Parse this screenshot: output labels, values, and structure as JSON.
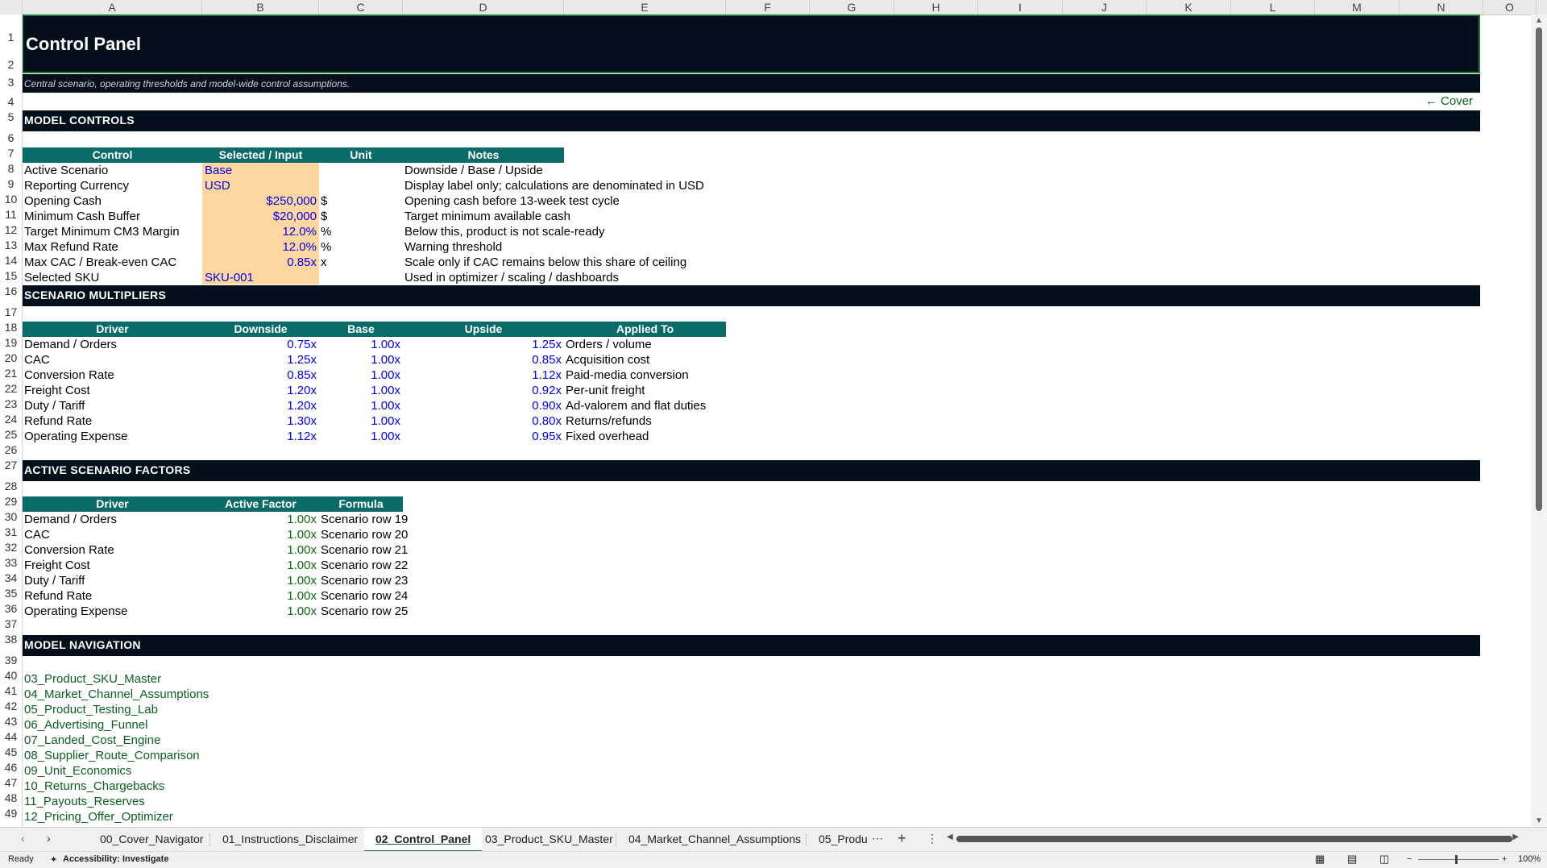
{
  "columns": [
    "A",
    "B",
    "C",
    "D",
    "E",
    "F",
    "G",
    "H",
    "I",
    "J",
    "K",
    "L",
    "M",
    "N",
    "O"
  ],
  "rows": [
    "1",
    "2",
    "3",
    "4",
    "5",
    "6",
    "7",
    "8",
    "9",
    "10",
    "11",
    "12",
    "13",
    "14",
    "15",
    "16",
    "17",
    "18",
    "19",
    "20",
    "21",
    "22",
    "23",
    "24",
    "25",
    "26",
    "27",
    "28",
    "29",
    "30",
    "31",
    "32",
    "33",
    "34",
    "35",
    "36",
    "37",
    "38",
    "39",
    "40",
    "41",
    "42",
    "43",
    "44",
    "45",
    "46",
    "47",
    "48",
    "49"
  ],
  "sheet": {
    "title": "Control Panel",
    "subtitle": "Central scenario, operating thresholds and model-wide control assumptions.",
    "cover_link": "← Cover",
    "model_controls": {
      "heading": "MODEL CONTROLS",
      "headers": [
        "Control",
        "Selected / Input",
        "Unit",
        "Notes"
      ],
      "rows": [
        {
          "control": "Active Scenario",
          "value": "Base",
          "unit": "",
          "notes": "Downside / Base / Upside"
        },
        {
          "control": "Reporting Currency",
          "value": "USD",
          "unit": "",
          "notes": "Display label only; calculations are denominated in USD"
        },
        {
          "control": "Opening Cash",
          "value": "$250,000",
          "unit": "$",
          "notes": "Opening cash before 13-week test cycle"
        },
        {
          "control": "Minimum Cash Buffer",
          "value": "$20,000",
          "unit": "$",
          "notes": "Target minimum available cash"
        },
        {
          "control": "Target Minimum CM3 Margin",
          "value": "12.0%",
          "unit": "%",
          "notes": "Below this, product is not scale-ready"
        },
        {
          "control": "Max Refund Rate",
          "value": "12.0%",
          "unit": "%",
          "notes": "Warning threshold"
        },
        {
          "control": "Max CAC / Break-even CAC",
          "value": "0.85x",
          "unit": "x",
          "notes": "Scale only if CAC remains below this share of ceiling"
        },
        {
          "control": "Selected SKU",
          "value": "SKU-001",
          "unit": "",
          "notes": "Used in optimizer / scaling / dashboards"
        }
      ]
    },
    "scenario_multipliers": {
      "heading": "SCENARIO MULTIPLIERS",
      "headers": [
        "Driver",
        "Downside",
        "Base",
        "Upside",
        "Applied To"
      ],
      "rows": [
        {
          "driver": "Demand / Orders",
          "downside": "0.75x",
          "base": "1.00x",
          "upside": "1.25x",
          "applied": "Orders / volume"
        },
        {
          "driver": "CAC",
          "downside": "1.25x",
          "base": "1.00x",
          "upside": "0.85x",
          "applied": "Acquisition cost"
        },
        {
          "driver": "Conversion Rate",
          "downside": "0.85x",
          "base": "1.00x",
          "upside": "1.12x",
          "applied": "Paid-media conversion"
        },
        {
          "driver": "Freight Cost",
          "downside": "1.20x",
          "base": "1.00x",
          "upside": "0.92x",
          "applied": "Per-unit freight"
        },
        {
          "driver": "Duty / Tariff",
          "downside": "1.20x",
          "base": "1.00x",
          "upside": "0.90x",
          "applied": "Ad-valorem and flat duties"
        },
        {
          "driver": "Refund Rate",
          "downside": "1.30x",
          "base": "1.00x",
          "upside": "0.80x",
          "applied": "Returns/refunds"
        },
        {
          "driver": "Operating Expense",
          "downside": "1.12x",
          "base": "1.00x",
          "upside": "0.95x",
          "applied": "Fixed overhead"
        }
      ]
    },
    "active_factors": {
      "heading": "ACTIVE SCENARIO FACTORS",
      "headers": [
        "Driver",
        "Active Factor",
        "Formula"
      ],
      "rows": [
        {
          "driver": "Demand / Orders",
          "factor": "1.00x",
          "formula": "Scenario row 19"
        },
        {
          "driver": "CAC",
          "factor": "1.00x",
          "formula": "Scenario row 20"
        },
        {
          "driver": "Conversion Rate",
          "factor": "1.00x",
          "formula": "Scenario row 21"
        },
        {
          "driver": "Freight Cost",
          "factor": "1.00x",
          "formula": "Scenario row 22"
        },
        {
          "driver": "Duty / Tariff",
          "factor": "1.00x",
          "formula": "Scenario row 23"
        },
        {
          "driver": "Refund Rate",
          "factor": "1.00x",
          "formula": "Scenario row 24"
        },
        {
          "driver": "Operating Expense",
          "factor": "1.00x",
          "formula": "Scenario row 25"
        }
      ]
    },
    "navigation": {
      "heading": "MODEL NAVIGATION",
      "links": [
        "03_Product_SKU_Master",
        "04_Market_Channel_Assumptions",
        "05_Product_Testing_Lab",
        "06_Advertising_Funnel",
        "07_Landed_Cost_Engine",
        "08_Supplier_Route_Comparison",
        "09_Unit_Economics",
        "10_Returns_Chargebacks",
        "11_Payouts_Reserves",
        "12_Pricing_Offer_Optimizer"
      ]
    }
  },
  "tabs": {
    "items": [
      "00_Cover_Navigator",
      "01_Instructions_Disclaimer",
      "02_Control_Panel",
      "03_Product_SKU_Master",
      "04_Market_Channel_Assumptions",
      "05_Produ"
    ],
    "active": "02_Control_Panel",
    "more": "⋯",
    "add": "+",
    "options": "⋮"
  },
  "status": {
    "ready": "Ready",
    "accessibility": "Accessibility: Investigate",
    "zoom": "100%"
  },
  "colors": {
    "band": "#03101c",
    "table_header": "#0b6b68",
    "input_fill": "#fdd6a0",
    "input_text": "#0000ee",
    "formula_text": "#0a6b0a"
  }
}
